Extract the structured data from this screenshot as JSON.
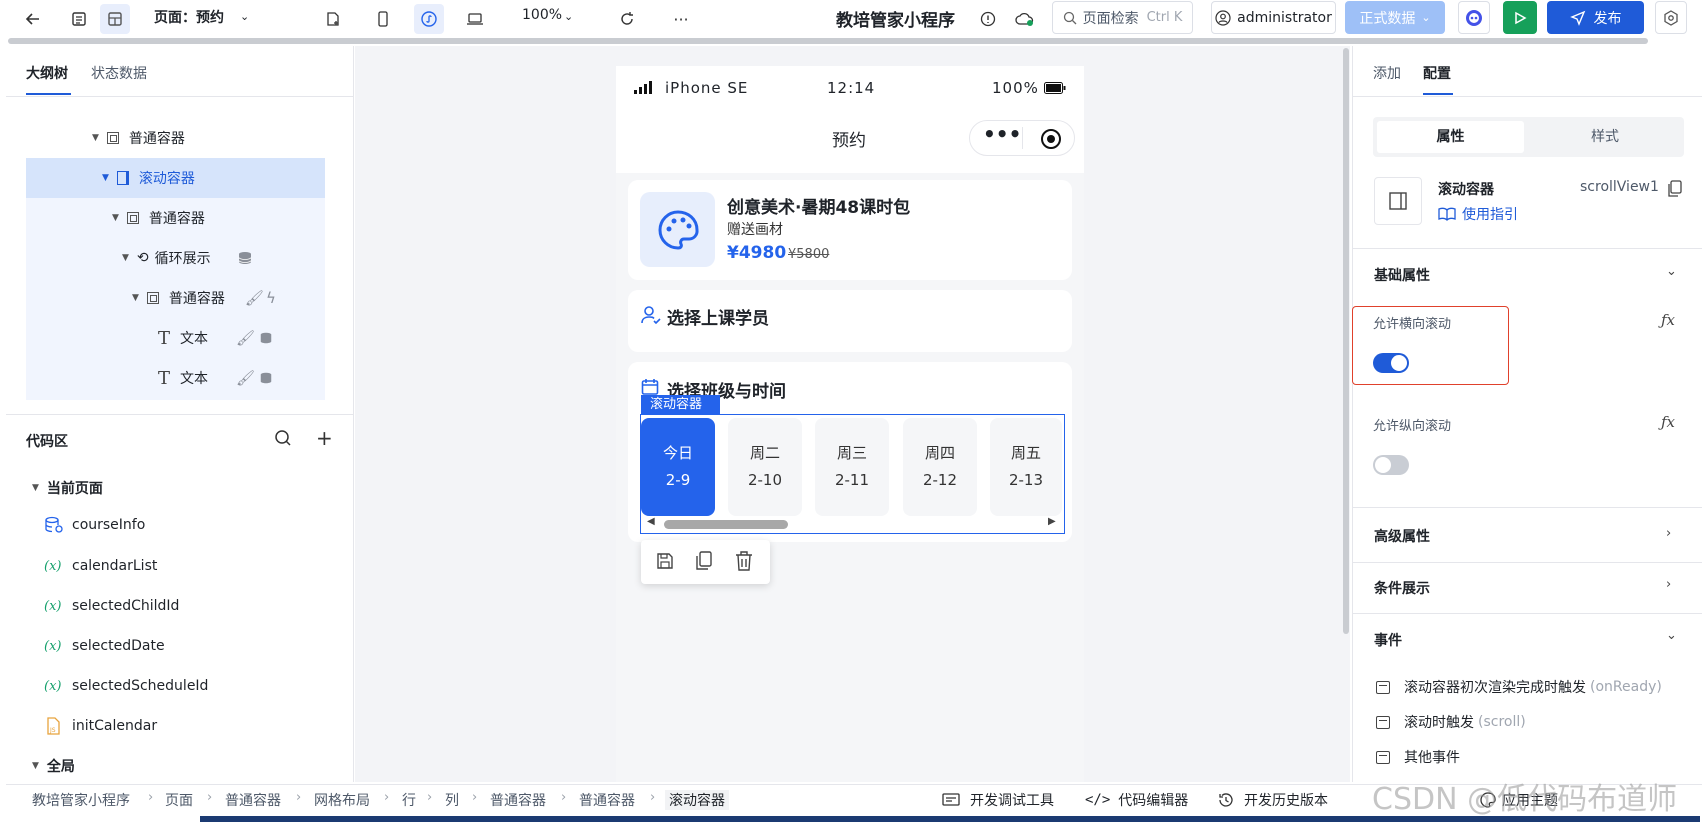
{
  "topbar": {
    "page_label": "页面：预约",
    "zoom": "100%",
    "app_title": "教培管家小程序",
    "search_placeholder": "页面检索",
    "search_shortcut": "Ctrl K",
    "user": "administrator",
    "env_button": "正式数据",
    "publish_button": "发布",
    "accent": "#1f5bd8",
    "run_color": "#16a05a"
  },
  "left": {
    "tabs": [
      "大纲树",
      "状态数据"
    ],
    "tree": [
      {
        "label": "普通容器",
        "icon": "container-icon"
      },
      {
        "label": "滚动容器",
        "icon": "scroll-container-icon"
      },
      {
        "label": "普通容器",
        "icon": "container-icon"
      },
      {
        "label": "循环展示",
        "icon": "loop-icon"
      },
      {
        "label": "普通容器",
        "icon": "container-icon"
      },
      {
        "label": "文本",
        "icon": "text-icon"
      },
      {
        "label": "文本",
        "icon": "text-icon"
      }
    ],
    "code_title": "代码区",
    "current_page": "当前页面",
    "code_items": [
      "courseInfo",
      "calendarList",
      "selectedChildId",
      "selectedDate",
      "selectedScheduleId",
      "initCalendar"
    ],
    "global": "全局"
  },
  "phone": {
    "device": "iPhone SE",
    "time": "12:14",
    "battery": "100%",
    "page_title": "预约",
    "course_title": "创意美术·暑期48课时包",
    "course_gift": "赠送画材",
    "price": "¥4980",
    "old_price": "¥5800",
    "student_section": "选择上课学员",
    "schedule_section": "选择班级与时间",
    "scroll_tag": "滚动容器",
    "days": [
      {
        "week": "今日",
        "date": "2-9"
      },
      {
        "week": "周二",
        "date": "2-10"
      },
      {
        "week": "周三",
        "date": "2-11"
      },
      {
        "week": "周四",
        "date": "2-12"
      },
      {
        "week": "周五",
        "date": "2-13"
      }
    ]
  },
  "right": {
    "tabs": [
      "添加",
      "配置"
    ],
    "subtabs": [
      "属性",
      "样式"
    ],
    "component_name": "滚动容器",
    "component_id": "scrollView1",
    "guide_link": "使用指引",
    "basic_section": "基础属性",
    "allow_horizontal": "允许横向滚动",
    "allow_horizontal_value": true,
    "allow_vertical": "允许纵向滚动",
    "allow_vertical_value": false,
    "advanced_section": "高级属性",
    "condition_section": "条件展示",
    "event_section": "事件",
    "events": [
      {
        "label": "滚动容器初次渲染完成时触发",
        "hint": "(onReady)"
      },
      {
        "label": "滚动时触发",
        "hint": "(scroll)"
      },
      {
        "label": "其他事件",
        "hint": ""
      }
    ]
  },
  "bottom": {
    "breadcrumb": [
      "教培管家小程序",
      "页面",
      "普通容器",
      "网格布局",
      "行",
      "列",
      "普通容器",
      "普通容器",
      "滚动容器"
    ],
    "tools": [
      "开发调试工具",
      "代码编辑器",
      "开发历史版本",
      "应用主题"
    ],
    "watermark": "CSDN @低代码布道师"
  }
}
